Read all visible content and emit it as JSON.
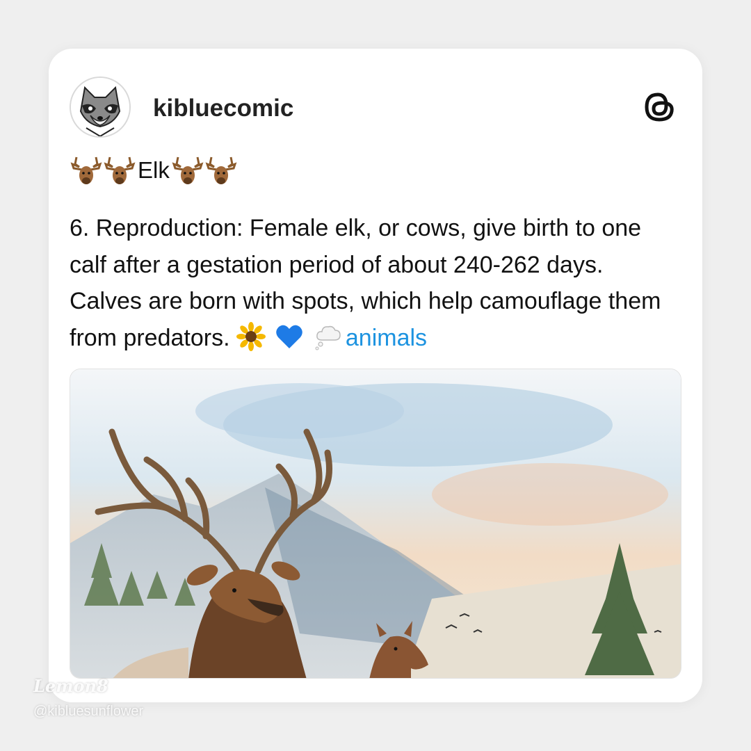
{
  "post": {
    "username": "kibluecomic",
    "title": "Elk",
    "body": "6. Reproduction: Female elk, or cows, give birth to one calf after a gestation period of about 240-262 days. Calves are born with spots, which help camouflage them from predators.",
    "hashtag": "animals",
    "icons": [
      "elk-icon",
      "sunflower-icon",
      "blue-heart-icon",
      "thought-bubble-icon",
      "threads-logo-icon"
    ]
  },
  "watermark": {
    "brand": "Lemon8",
    "handle": "@kibluesunflower"
  },
  "colors": {
    "background": "#efefef",
    "card": "#ffffff",
    "hashtag": "#1d93e0",
    "text": "#111111"
  }
}
